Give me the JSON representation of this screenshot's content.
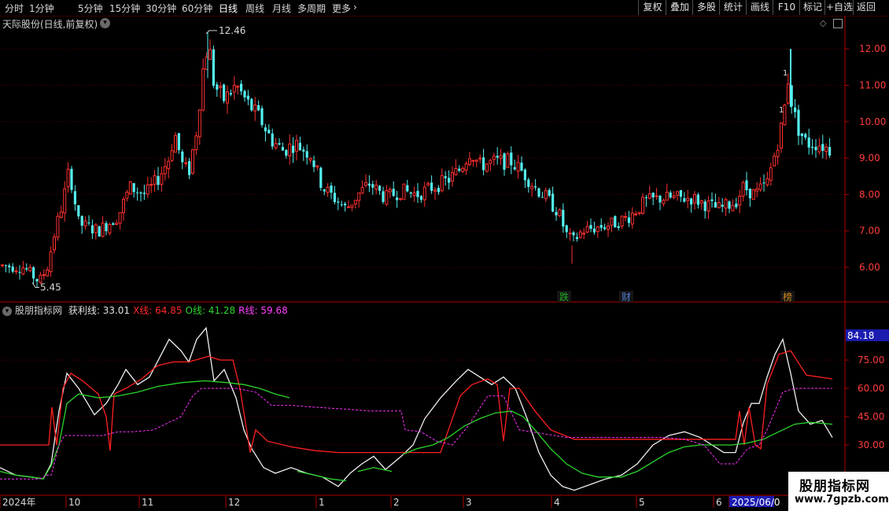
{
  "toolbar": {
    "periods": [
      {
        "label": "分时",
        "x": 6
      },
      {
        "label": "1分钟",
        "x": 37
      },
      {
        "label": "5分钟",
        "x": 99
      },
      {
        "label": "15分钟",
        "x": 139
      },
      {
        "label": "30分钟",
        "x": 185
      },
      {
        "label": "60分钟",
        "x": 231
      },
      {
        "label": "日线",
        "x": 278
      },
      {
        "label": "周线",
        "x": 312
      },
      {
        "label": "月线",
        "x": 346
      },
      {
        "label": "多周期",
        "x": 378
      },
      {
        "label": "更多",
        "x": 422
      }
    ],
    "right_buttons": [
      "复权",
      "叠加",
      "多股",
      "统计",
      "画线",
      "F10",
      "标记",
      "+自选",
      "返回"
    ]
  },
  "main_chart": {
    "title": "天际股份(日线,前复权)",
    "high_label": "12.46",
    "low_label": "5.45",
    "y_ticks": [
      "12.00",
      "11.00",
      "10.00",
      "9.00",
      "8.00",
      "7.00",
      "6.00"
    ],
    "y_values": [
      12,
      11,
      10,
      9,
      8,
      7,
      6
    ],
    "event_markers": [
      {
        "label": "跌",
        "color": "#1fae1f"
      },
      {
        "label": "财",
        "color": "#4f7bd6"
      },
      {
        "label": "榜",
        "color": "#d08a1a"
      }
    ]
  },
  "indicator": {
    "name": "股朋指标网",
    "items": [
      {
        "text": "获利线: 33.01",
        "color": "#e0e0e0"
      },
      {
        "text": "X线: 64.85",
        "color": "#ff2a2a"
      },
      {
        "text": "O线: 41.28",
        "color": "#2bd62b"
      },
      {
        "text": "R线: 59.68",
        "color": "#ff40ff"
      }
    ],
    "y_ticks": [
      "75.00",
      "60.00",
      "45.00",
      "30.00"
    ],
    "y_values": [
      75,
      60,
      45,
      30
    ],
    "current_value": "84.18"
  },
  "x_axis": {
    "labels": [
      "2024年",
      "10",
      "11",
      "12",
      "1",
      "2",
      "3",
      "4",
      "5",
      "6",
      "2025/06/0"
    ]
  },
  "watermark": {
    "line1": "股朋指标网",
    "line2": "www.7gpzb.com"
  },
  "colors": {
    "up": "#ff3030",
    "down": "#54f0f0",
    "grid": "#5a0000",
    "axis": "#b00000"
  }
}
